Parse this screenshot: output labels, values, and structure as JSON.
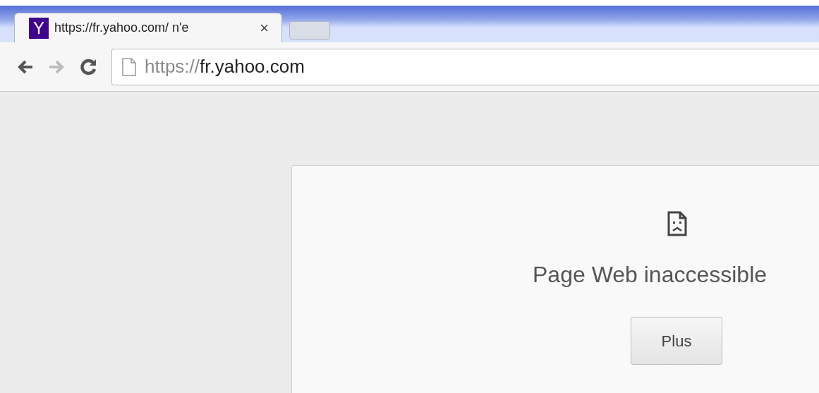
{
  "tab": {
    "title": "https://fr.yahoo.com/ n'e",
    "favicon_letter": "Y",
    "close": "×"
  },
  "address_bar": {
    "scheme": "https://",
    "host": "fr.yahoo.com"
  },
  "toolbar": {
    "forward_disabled": true
  },
  "error": {
    "title": "Page Web inaccessible",
    "button": "Plus"
  }
}
